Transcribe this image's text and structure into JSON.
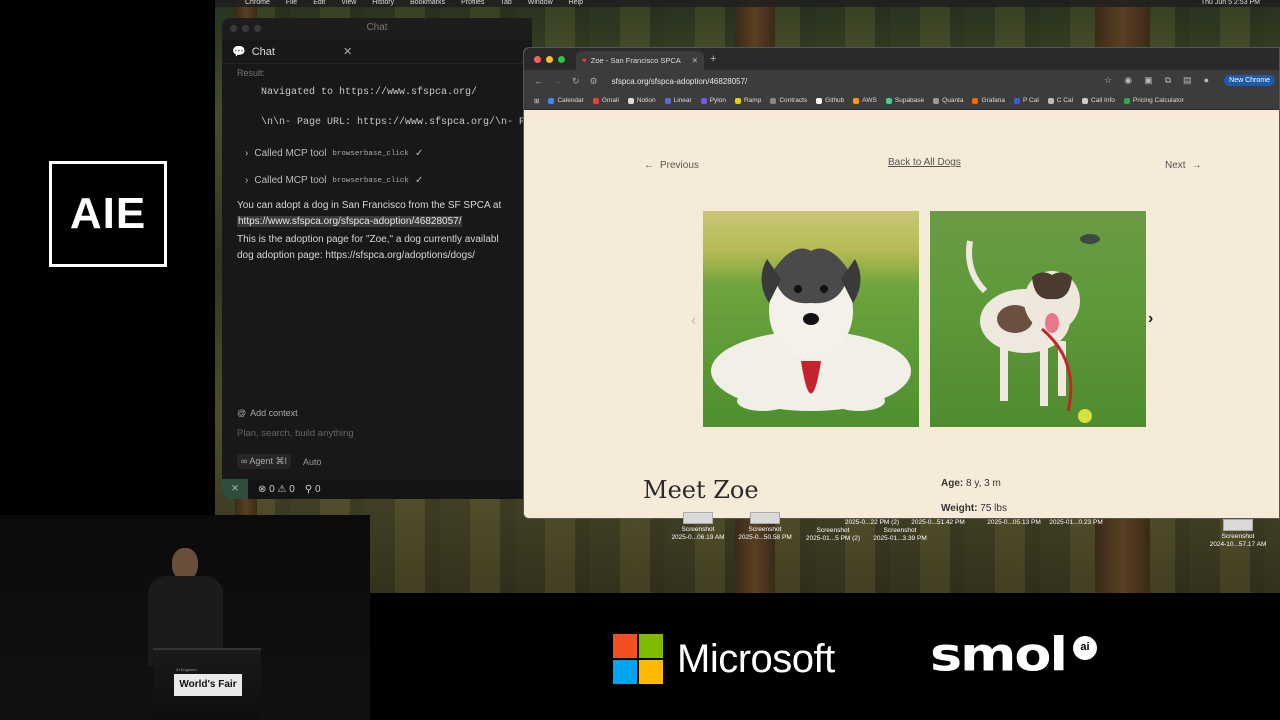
{
  "conference": {
    "logo_text": "AIE"
  },
  "menubar": {
    "items": [
      "Chrome",
      "File",
      "Edit",
      "View",
      "History",
      "Bookmarks",
      "Profiles",
      "Tab",
      "Window",
      "Help"
    ],
    "clock": "Thu Jun 5  2:53 PM"
  },
  "cursor": {
    "window_title": "Chat",
    "tab_label": "Chat",
    "result_label": "Result:",
    "navigated_text": "Navigated to https://www.sfspca.org/",
    "page_url_text": "\\n\\n- Page URL: https://www.sfspca.org/\\n- Pag",
    "tool_calls": [
      {
        "label": "Called MCP tool",
        "tool": "browserbase_click",
        "check": "✓"
      },
      {
        "label": "Called MCP tool",
        "tool": "browserbase_click",
        "check": "✓"
      }
    ],
    "answer_line1": "You can adopt a dog in San Francisco from the SF SPCA at",
    "answer_link": "https://www.sfspca.org/sfspca-adoption/46828057/",
    "answer_line3": "This is the adoption page for \"Zoe,\" a dog currently availabl",
    "answer_line4": "dog adoption page: https://sfspca.org/adoptions/dogs/",
    "add_context": "Add context",
    "input_placeholder": "Plan, search, build anything",
    "agent_label": "Agent",
    "agent_shortcut": "⌘I",
    "mode": "Auto",
    "status_errors": "0",
    "status_warnings": "0",
    "status_other": "0"
  },
  "chrome": {
    "tab_title": "Zoe - San Francisco SPCA",
    "url": "sfspca.org/sfspca-adoption/46828057/",
    "new_chrome": "New Chrome",
    "bookmarks": [
      {
        "label": "Calendar",
        "color": "#4285f4"
      },
      {
        "label": "Gmail",
        "color": "#ea4335"
      },
      {
        "label": "Notion",
        "color": "#dddddd"
      },
      {
        "label": "Linear",
        "color": "#5e6ad2"
      },
      {
        "label": "Pylon",
        "color": "#6c5ce7"
      },
      {
        "label": "Ramp",
        "color": "#e4d10a"
      },
      {
        "label": "Contracts",
        "color": "#888888"
      },
      {
        "label": "Github",
        "color": "#ffffff"
      },
      {
        "label": "AWS",
        "color": "#ff9900"
      },
      {
        "label": "Supabase",
        "color": "#3ecf8e"
      },
      {
        "label": "Quanta",
        "color": "#999999"
      },
      {
        "label": "Grafana",
        "color": "#f46800"
      },
      {
        "label": "P Cal",
        "color": "#3b5bdb"
      },
      {
        "label": "C Cal",
        "color": "#bbbbbb"
      },
      {
        "label": "Call Info",
        "color": "#cccccc"
      },
      {
        "label": "Pricing Calculator",
        "color": "#34a853"
      }
    ]
  },
  "page": {
    "previous": "Previous",
    "back": "Back to All Dogs",
    "next": "Next",
    "heading": "Meet Zoe",
    "age_label": "Age:",
    "age_value": "8 y, 3 m",
    "weight_label": "Weight:",
    "weight_value": "75 lbs"
  },
  "desktop_files": [
    {
      "name": "Screenshot",
      "date": "2025-0...06.19 AM"
    },
    {
      "name": "Screenshot",
      "date": "2025-0...50.58 PM"
    },
    {
      "name": "Screenshot",
      "date": "2025-01...5 PM (2)"
    },
    {
      "name": "Screenshot",
      "date": "2025-01...3.39 PM"
    },
    {
      "name": "Screenshot",
      "date": "2024-10...57.17 AM"
    }
  ],
  "desktop_partial_labels": [
    "2025-0...22 PM (2)",
    "2025-0...51.42 PM",
    "2025-0...05.13 PM",
    "2025-01...0.23 PM"
  ],
  "podium": {
    "sign": "World's Fair",
    "small": "AI Engineer"
  },
  "sponsors": {
    "microsoft": "Microsoft",
    "smol": "smol",
    "smol_badge": "ai"
  }
}
